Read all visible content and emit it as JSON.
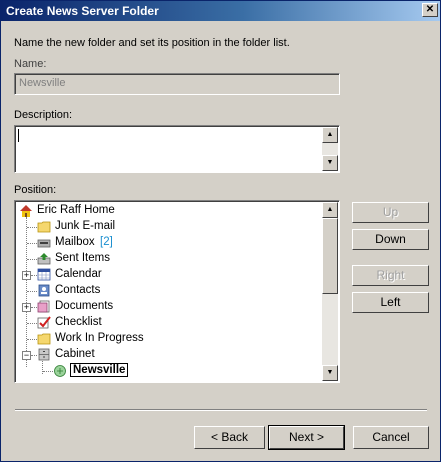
{
  "window": {
    "title": "Create News Server Folder"
  },
  "instructions": "Name the new folder and set its position in the folder list.",
  "name": {
    "label": "Name:",
    "value": "Newsville"
  },
  "description": {
    "label": "Description:",
    "value": ""
  },
  "position": {
    "label": "Position:",
    "tree": [
      {
        "label": "Eric Raff Home",
        "icon": "home-icon",
        "level": 0
      },
      {
        "label": "Junk E-mail",
        "icon": "folder-icon",
        "level": 1
      },
      {
        "label": "Mailbox",
        "icon": "mailbox-icon",
        "level": 1,
        "count": "[2]"
      },
      {
        "label": "Sent Items",
        "icon": "sent-items-icon",
        "level": 1
      },
      {
        "label": "Calendar",
        "icon": "calendar-icon",
        "level": 1,
        "expander": "+"
      },
      {
        "label": "Contacts",
        "icon": "contacts-icon",
        "level": 1
      },
      {
        "label": "Documents",
        "icon": "documents-icon",
        "level": 1,
        "expander": "+"
      },
      {
        "label": "Checklist",
        "icon": "checklist-icon",
        "level": 1
      },
      {
        "label": "Work In Progress",
        "icon": "folder-icon",
        "level": 1
      },
      {
        "label": "Cabinet",
        "icon": "cabinet-icon",
        "level": 1,
        "expander": "−"
      },
      {
        "label": "Newsville",
        "icon": "news-folder-icon",
        "level": 2,
        "selected": true
      }
    ]
  },
  "side_buttons": {
    "up": "Up",
    "down": "Down",
    "right": "Right",
    "left": "Left"
  },
  "footer_buttons": {
    "back": "< Back",
    "next": "Next >",
    "cancel": "Cancel"
  },
  "colors": {
    "accent": "#0a246a",
    "count": "#1a8fd0",
    "face": "#d4d0c8"
  }
}
